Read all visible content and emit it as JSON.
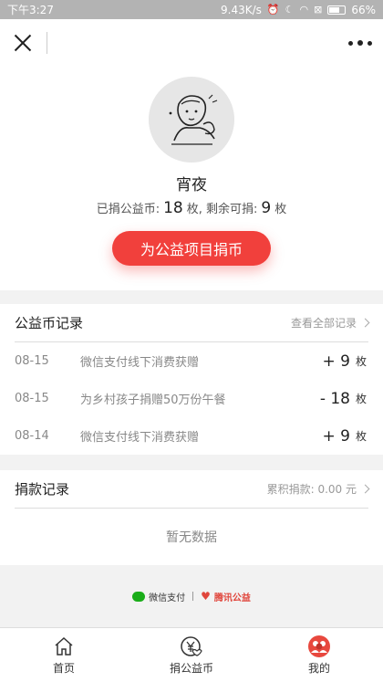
{
  "status_bar": {
    "time": "下午3:27",
    "network_speed": "9.43K/s",
    "battery": "66%"
  },
  "header": {
    "close_icon": "close-icon",
    "more_icon": "more-dots-icon"
  },
  "profile": {
    "nickname": "宵夜",
    "donated_label": "已捐公益币:",
    "donated_count": "18",
    "donated_unit": "枚,",
    "remaining_label": "剩余可捐:",
    "remaining_count": "9",
    "remaining_unit": "枚",
    "donate_button": "为公益项目捐币"
  },
  "coin_records": {
    "title": "公益币记录",
    "view_all": "查看全部记录",
    "rows": [
      {
        "date": "08-15",
        "desc": "微信支付线下消费获赠",
        "amount": "+ 9",
        "unit": "枚"
      },
      {
        "date": "08-15",
        "desc": "为乡村孩子捐赠50万份午餐",
        "amount": "- 18",
        "unit": "枚"
      },
      {
        "date": "08-14",
        "desc": "微信支付线下消费获赠",
        "amount": "+ 9",
        "unit": "枚"
      }
    ]
  },
  "donation_records": {
    "title": "捐款记录",
    "total_label": "累积捐款:",
    "total_value": "0.00 元",
    "empty_text": "暂无数据"
  },
  "footer_logos": {
    "wechat_pay": "微信支付",
    "tencent_charity": "腾讯公益"
  },
  "nav": {
    "home": "首页",
    "donate_coin": "捐公益币",
    "mine": "我的"
  },
  "colors": {
    "accent": "#f1403c",
    "wechat_green": "#1aad19"
  }
}
